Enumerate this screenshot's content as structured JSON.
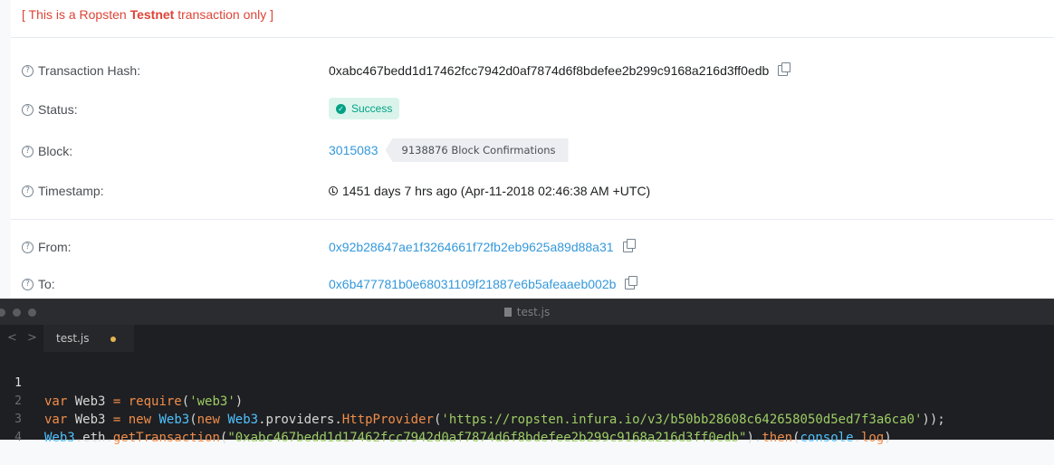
{
  "explorer": {
    "testnet_notice_prefix": "[ This is a Ropsten ",
    "testnet_notice_bold": "Testnet",
    "testnet_notice_suffix": " transaction only ]",
    "rows": {
      "hash": {
        "label": "Transaction Hash:",
        "value": "0xabc467bedd1d17462fcc7942d0af7874d6f8bdefee2b299c9168a216d3ff0edb"
      },
      "status": {
        "label": "Status:",
        "value": "Success"
      },
      "block": {
        "label": "Block:",
        "value": "3015083",
        "confirmations": "9138876 Block Confirmations"
      },
      "timestamp": {
        "label": "Timestamp:",
        "value": "1451 days 7 hrs ago (Apr-11-2018 02:46:38 AM +UTC)"
      },
      "from": {
        "label": "From:",
        "value": "0x92b28647ae1f3264661f72fb2eb9625a89d88a31"
      },
      "to": {
        "label": "To:",
        "value": "0x6b477781b0e68031109f21887e6b5afeaaeb002b"
      }
    }
  },
  "editor": {
    "window_title": "test.js",
    "tab_label": "test.js",
    "nav_back": "<",
    "nav_forward": ">",
    "line_numbers": [
      "1",
      "2",
      "3",
      "4"
    ],
    "lines": {
      "l1": {
        "kw": "var",
        "id": " Web3 ",
        "op": "= ",
        "fn": "require",
        "p1": "(",
        "str": "'web3'",
        "p2": ")"
      },
      "l2": {
        "kw": "var",
        "id": " Web3 ",
        "op": "= ",
        "kw2": "new",
        "cls": " Web3",
        "p1": "(",
        "kw3": "new",
        "cls2": " Web3",
        "dot1": ".providers.",
        "cls3": "HttpProvider",
        "p2": "(",
        "str": "'https://ropsten.infura.io/v3/b50bb28608c642658050d5ed7f3a6ca0'",
        "p3": "));"
      },
      "l3": {
        "cls": "Web3",
        "dot1": ".eth.",
        "fn": "getTransaction",
        "p1": "(",
        "str": "\"0xabc467bedd1d17462fcc7942d0af7874d6f8bdefee2b299c9168a216d3ff0edb\"",
        "p2": ").",
        "fn2": "then",
        "p3": "(",
        "cls2": "console",
        "dot2": ".",
        "prop": "log",
        "p4": ")"
      }
    }
  }
}
